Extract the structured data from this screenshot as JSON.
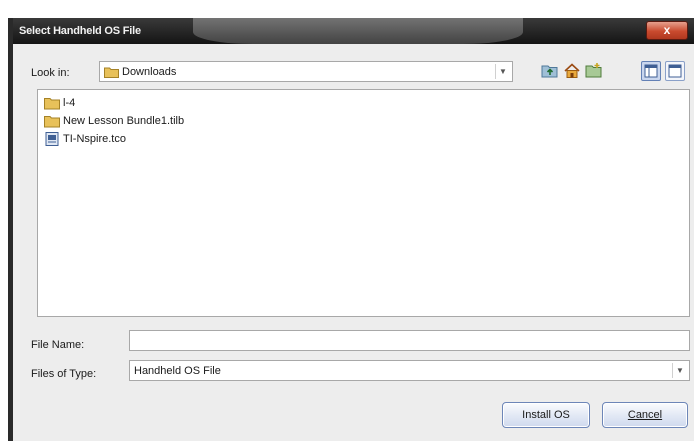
{
  "window": {
    "title": "Select Handheld OS File",
    "close_label": "x"
  },
  "lookin": {
    "label": "Look in:",
    "value": "Downloads"
  },
  "toolbar": {
    "icons": [
      "up-folder-icon",
      "home-icon",
      "new-folder-icon",
      "list-view-icon",
      "details-view-icon"
    ]
  },
  "files": [
    {
      "name": "l-4",
      "icon": "folder-icon"
    },
    {
      "name": "New Lesson Bundle1.tilb",
      "icon": "folder-icon"
    },
    {
      "name": "TI-Nspire.tco",
      "icon": "os-file-icon"
    }
  ],
  "file_name": {
    "label": "File Name:",
    "value": ""
  },
  "file_type": {
    "label": "Files of Type:",
    "value": "Handheld OS File"
  },
  "buttons": {
    "install": "Install OS",
    "cancel": "Cancel"
  },
  "colors": {
    "title_bar": "#1c1c1c",
    "close_button": "#c94a2e",
    "dialog_bg": "#ededed",
    "folder_yellow": "#e8c15a"
  }
}
